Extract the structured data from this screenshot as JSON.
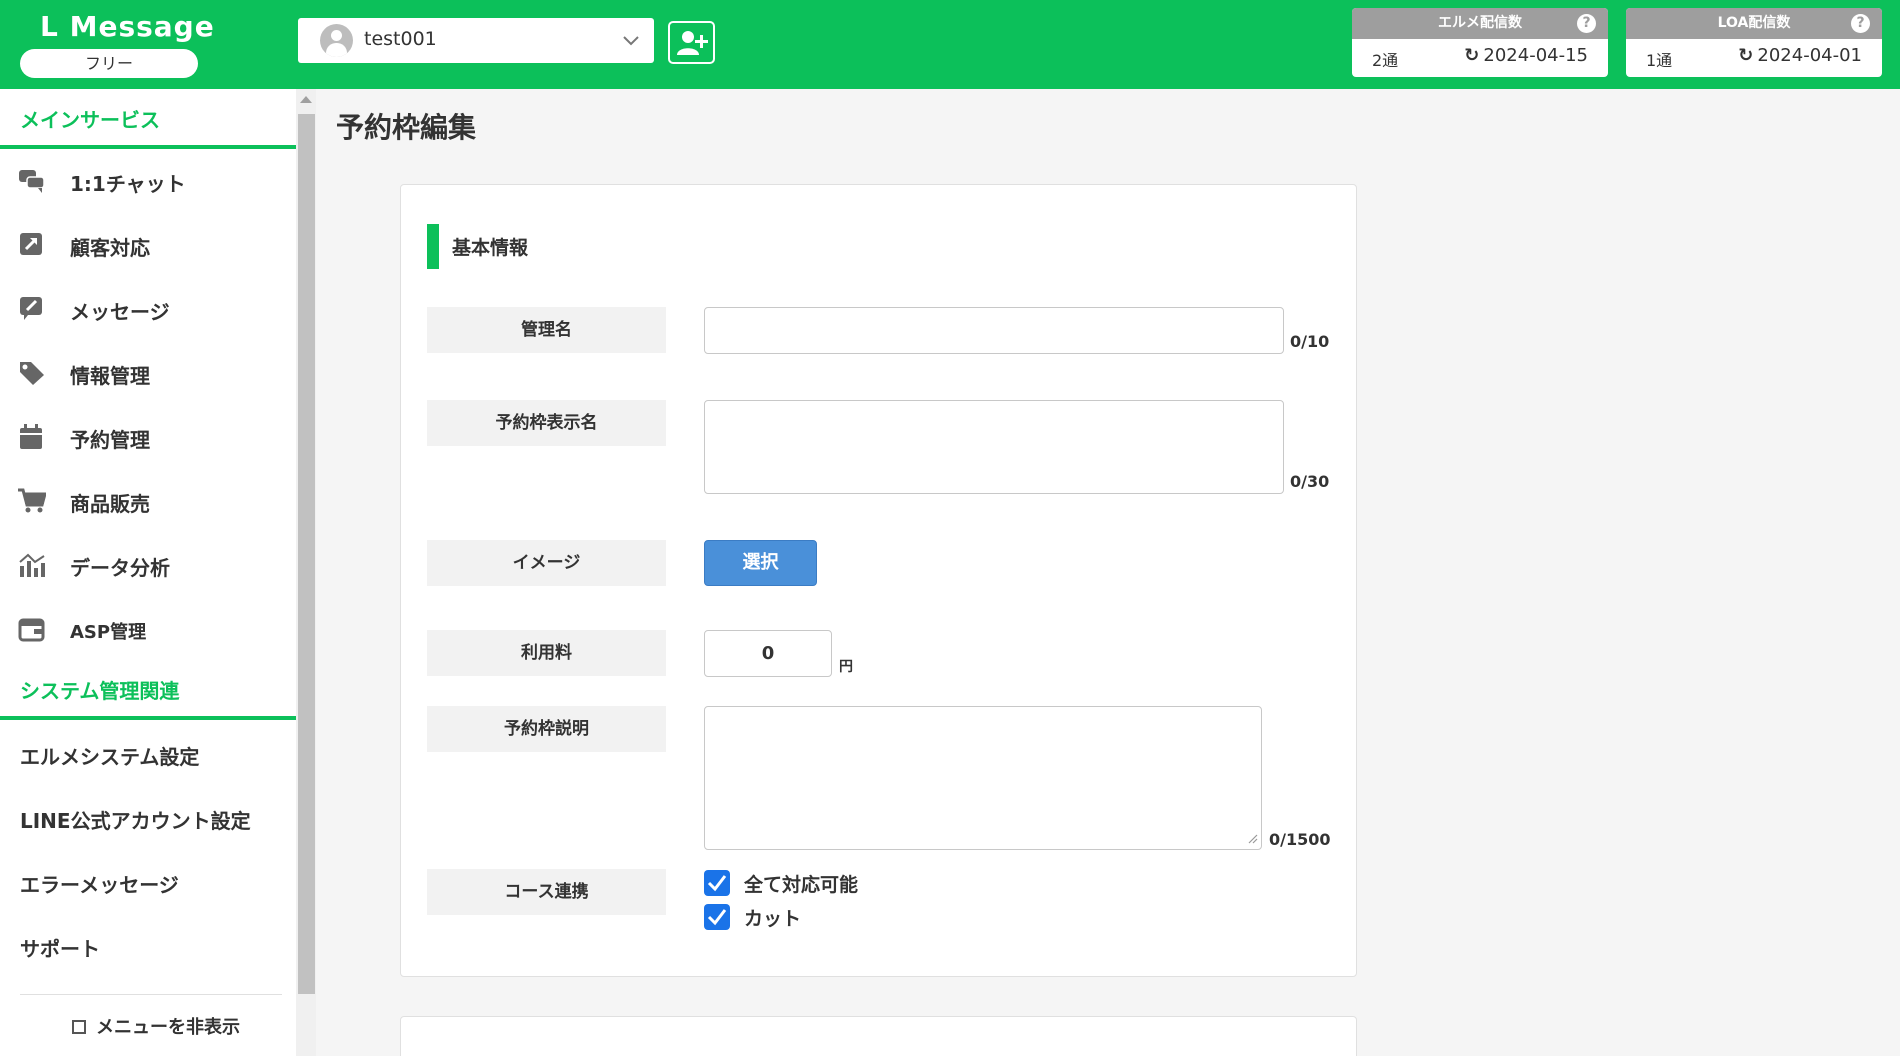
{
  "header": {
    "logo": "L Message",
    "plan": "フリー",
    "account_name": "test001",
    "quota_lme": {
      "title": "エルメ配信数",
      "count": "2通",
      "date": "2024-04-15"
    },
    "quota_loa": {
      "title": "LOA配信数",
      "count": "1通",
      "date": "2024-04-01"
    },
    "help_glyph": "?"
  },
  "sidebar": {
    "main_section": "メインサービス",
    "main_items": [
      {
        "label": "1:1チャット",
        "icon": "chat-icon"
      },
      {
        "label": "顧客対応",
        "icon": "arrow-square-icon"
      },
      {
        "label": "メッセージ",
        "icon": "edit-message-icon"
      },
      {
        "label": "情報管理",
        "icon": "tag-icon"
      },
      {
        "label": "予約管理",
        "icon": "calendar-icon"
      },
      {
        "label": "商品販売",
        "icon": "cart-icon"
      },
      {
        "label": "データ分析",
        "icon": "chart-icon"
      },
      {
        "label": "ASP管理",
        "icon": "wallet-icon"
      }
    ],
    "system_section": "システム管理関連",
    "system_items": [
      {
        "label": "エルメシステム設定"
      },
      {
        "label": "LINE公式アカウント設定"
      },
      {
        "label": "エラーメッセージ"
      },
      {
        "label": "サポート"
      }
    ],
    "hide_menu": "メニューを非表示"
  },
  "main": {
    "page_title": "予約枠編集",
    "section_title": "基本情報",
    "fields": {
      "admin_name": {
        "label": "管理名",
        "value": "",
        "counter": "0/10"
      },
      "display_name": {
        "label": "予約枠表示名",
        "value": "",
        "counter": "0/30"
      },
      "image": {
        "label": "イメージ",
        "button": "選択"
      },
      "fee": {
        "label": "利用料",
        "value": "0",
        "unit": "円"
      },
      "description": {
        "label": "予約枠説明",
        "value": "",
        "counter": "0/1500"
      },
      "course": {
        "label": "コース連携",
        "options": [
          {
            "label": "全て対応可能",
            "checked": true
          },
          {
            "label": "カット",
            "checked": true
          }
        ]
      }
    }
  },
  "colors": {
    "brand": "#0cc05a",
    "button": "#4a90d9",
    "checkbox": "#1a73e8"
  }
}
